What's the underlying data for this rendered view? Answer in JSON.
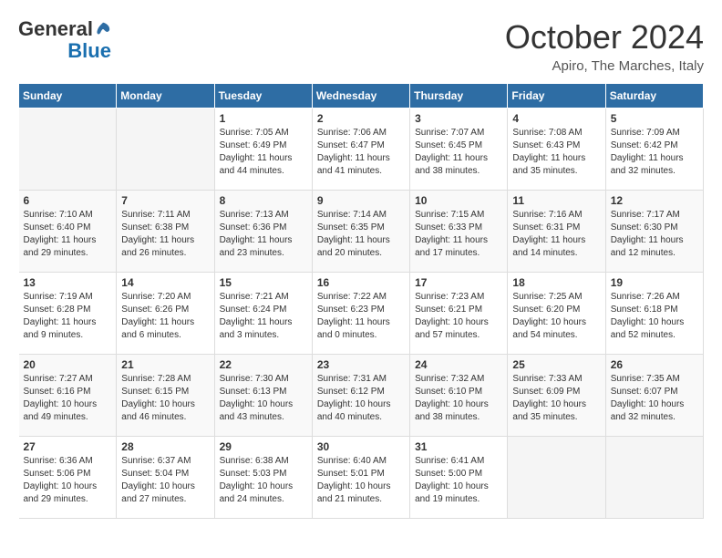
{
  "logo": {
    "general": "General",
    "blue": "Blue"
  },
  "title": "October 2024",
  "location": "Apiro, The Marches, Italy",
  "days_of_week": [
    "Sunday",
    "Monday",
    "Tuesday",
    "Wednesday",
    "Thursday",
    "Friday",
    "Saturday"
  ],
  "weeks": [
    [
      {
        "day": "",
        "empty": true
      },
      {
        "day": "",
        "empty": true
      },
      {
        "day": "1",
        "sunrise": "7:05 AM",
        "sunset": "6:49 PM",
        "daylight": "11 hours and 44 minutes."
      },
      {
        "day": "2",
        "sunrise": "7:06 AM",
        "sunset": "6:47 PM",
        "daylight": "11 hours and 41 minutes."
      },
      {
        "day": "3",
        "sunrise": "7:07 AM",
        "sunset": "6:45 PM",
        "daylight": "11 hours and 38 minutes."
      },
      {
        "day": "4",
        "sunrise": "7:08 AM",
        "sunset": "6:43 PM",
        "daylight": "11 hours and 35 minutes."
      },
      {
        "day": "5",
        "sunrise": "7:09 AM",
        "sunset": "6:42 PM",
        "daylight": "11 hours and 32 minutes."
      }
    ],
    [
      {
        "day": "6",
        "sunrise": "7:10 AM",
        "sunset": "6:40 PM",
        "daylight": "11 hours and 29 minutes."
      },
      {
        "day": "7",
        "sunrise": "7:11 AM",
        "sunset": "6:38 PM",
        "daylight": "11 hours and 26 minutes."
      },
      {
        "day": "8",
        "sunrise": "7:13 AM",
        "sunset": "6:36 PM",
        "daylight": "11 hours and 23 minutes."
      },
      {
        "day": "9",
        "sunrise": "7:14 AM",
        "sunset": "6:35 PM",
        "daylight": "11 hours and 20 minutes."
      },
      {
        "day": "10",
        "sunrise": "7:15 AM",
        "sunset": "6:33 PM",
        "daylight": "11 hours and 17 minutes."
      },
      {
        "day": "11",
        "sunrise": "7:16 AM",
        "sunset": "6:31 PM",
        "daylight": "11 hours and 14 minutes."
      },
      {
        "day": "12",
        "sunrise": "7:17 AM",
        "sunset": "6:30 PM",
        "daylight": "11 hours and 12 minutes."
      }
    ],
    [
      {
        "day": "13",
        "sunrise": "7:19 AM",
        "sunset": "6:28 PM",
        "daylight": "11 hours and 9 minutes."
      },
      {
        "day": "14",
        "sunrise": "7:20 AM",
        "sunset": "6:26 PM",
        "daylight": "11 hours and 6 minutes."
      },
      {
        "day": "15",
        "sunrise": "7:21 AM",
        "sunset": "6:24 PM",
        "daylight": "11 hours and 3 minutes."
      },
      {
        "day": "16",
        "sunrise": "7:22 AM",
        "sunset": "6:23 PM",
        "daylight": "11 hours and 0 minutes."
      },
      {
        "day": "17",
        "sunrise": "7:23 AM",
        "sunset": "6:21 PM",
        "daylight": "10 hours and 57 minutes."
      },
      {
        "day": "18",
        "sunrise": "7:25 AM",
        "sunset": "6:20 PM",
        "daylight": "10 hours and 54 minutes."
      },
      {
        "day": "19",
        "sunrise": "7:26 AM",
        "sunset": "6:18 PM",
        "daylight": "10 hours and 52 minutes."
      }
    ],
    [
      {
        "day": "20",
        "sunrise": "7:27 AM",
        "sunset": "6:16 PM",
        "daylight": "10 hours and 49 minutes."
      },
      {
        "day": "21",
        "sunrise": "7:28 AM",
        "sunset": "6:15 PM",
        "daylight": "10 hours and 46 minutes."
      },
      {
        "day": "22",
        "sunrise": "7:30 AM",
        "sunset": "6:13 PM",
        "daylight": "10 hours and 43 minutes."
      },
      {
        "day": "23",
        "sunrise": "7:31 AM",
        "sunset": "6:12 PM",
        "daylight": "10 hours and 40 minutes."
      },
      {
        "day": "24",
        "sunrise": "7:32 AM",
        "sunset": "6:10 PM",
        "daylight": "10 hours and 38 minutes."
      },
      {
        "day": "25",
        "sunrise": "7:33 AM",
        "sunset": "6:09 PM",
        "daylight": "10 hours and 35 minutes."
      },
      {
        "day": "26",
        "sunrise": "7:35 AM",
        "sunset": "6:07 PM",
        "daylight": "10 hours and 32 minutes."
      }
    ],
    [
      {
        "day": "27",
        "sunrise": "6:36 AM",
        "sunset": "5:06 PM",
        "daylight": "10 hours and 29 minutes."
      },
      {
        "day": "28",
        "sunrise": "6:37 AM",
        "sunset": "5:04 PM",
        "daylight": "10 hours and 27 minutes."
      },
      {
        "day": "29",
        "sunrise": "6:38 AM",
        "sunset": "5:03 PM",
        "daylight": "10 hours and 24 minutes."
      },
      {
        "day": "30",
        "sunrise": "6:40 AM",
        "sunset": "5:01 PM",
        "daylight": "10 hours and 21 minutes."
      },
      {
        "day": "31",
        "sunrise": "6:41 AM",
        "sunset": "5:00 PM",
        "daylight": "10 hours and 19 minutes."
      },
      {
        "day": "",
        "empty": true
      },
      {
        "day": "",
        "empty": true
      }
    ]
  ],
  "labels": {
    "sunrise": "Sunrise:",
    "sunset": "Sunset:",
    "daylight": "Daylight:"
  }
}
